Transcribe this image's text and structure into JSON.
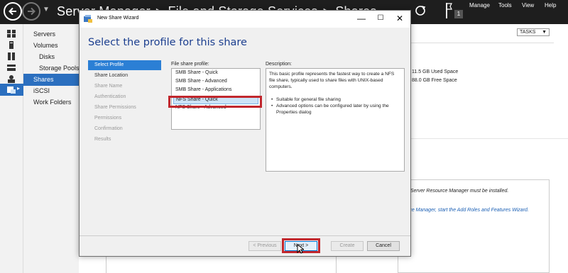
{
  "app": {
    "breadcrumb": [
      "Server Manager",
      "File and Storage Services",
      "Shares"
    ],
    "notification_count": "1",
    "menu": [
      "Manage",
      "Tools",
      "View",
      "Help"
    ]
  },
  "nav": {
    "items": [
      "Servers",
      "Volumes",
      "Disks",
      "Storage Pools",
      "Shares",
      "iSCSI",
      "Work Folders"
    ],
    "active": "Shares"
  },
  "background": {
    "tasks_label": "TASKS",
    "used_space": "11.5 GB Used Space",
    "free_space": "88.0 GB Free Space",
    "fsrm_note": "e Server Resource Manager must be installed.",
    "fsrm_link": "rce Manager, start the Add Roles and Features Wizard."
  },
  "wizard": {
    "window_title": "New Share Wizard",
    "heading": "Select the profile for this share",
    "steps": [
      "Select Profile",
      "Share Location",
      "Share Name",
      "Authentication",
      "Share Permissions",
      "Permissions",
      "Confirmation",
      "Results"
    ],
    "current_step": "Select Profile",
    "profile_label": "File share profile:",
    "profiles": [
      "SMB Share - Quick",
      "SMB Share - Advanced",
      "SMB Share - Applications",
      "NFS Share - Quick",
      "NFS Share - Advanced"
    ],
    "selected_profile": "NFS Share - Quick",
    "description_label": "Description:",
    "description_text": "This basic profile represents the fastest way to create a NFS file share, typically used to share files with UNIX-based computers.",
    "description_bullets": [
      "Suitable for general file sharing",
      "Advanced options can be configured later by using the Properties dialog"
    ],
    "buttons": {
      "previous": "< Previous",
      "next": "Next >",
      "create": "Create",
      "cancel": "Cancel"
    }
  },
  "colors": {
    "titlebar": "#1e1e1e",
    "accent": "#2b6fbf",
    "heading": "#1c3f8f",
    "highlight": "#c1272d"
  }
}
